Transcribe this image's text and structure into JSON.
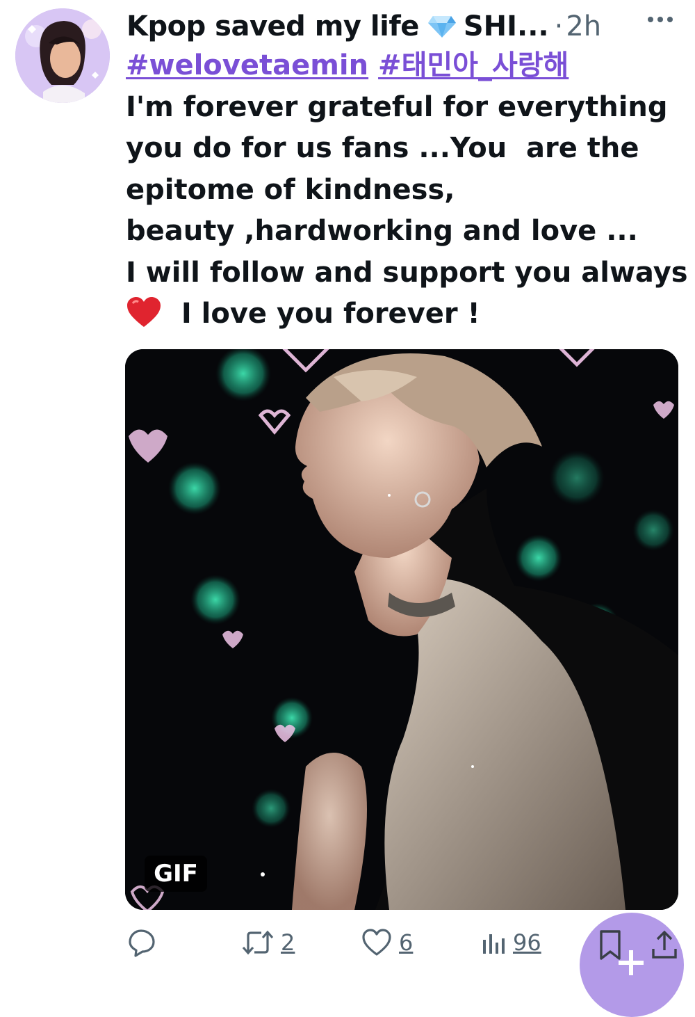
{
  "tweet": {
    "display_name": "Kpop saved my life",
    "name_emoji": "diamond-icon",
    "handle": "SHI...",
    "separator": "·",
    "time": "2h",
    "hashtags": [
      "#welovetaemin",
      "#태민아_사랑해"
    ],
    "lines": [
      "I'm forever grateful for everything",
      "you do for us fans ...You  are the",
      "epitome of kindness,",
      "beauty ,hardworking and love ...",
      "I will follow and support you always"
    ],
    "last_line": "I love you forever !",
    "last_line_emoji": "red-heart-emoji"
  },
  "media": {
    "badge": "GIF"
  },
  "actions": {
    "reply_icon": "reply-icon",
    "retweet_count": "2",
    "like_count": "6",
    "views_count": "96"
  },
  "colors": {
    "hashtag": "#7a4fd6",
    "fab": "#b39ae8",
    "secondary_text": "#536471"
  }
}
